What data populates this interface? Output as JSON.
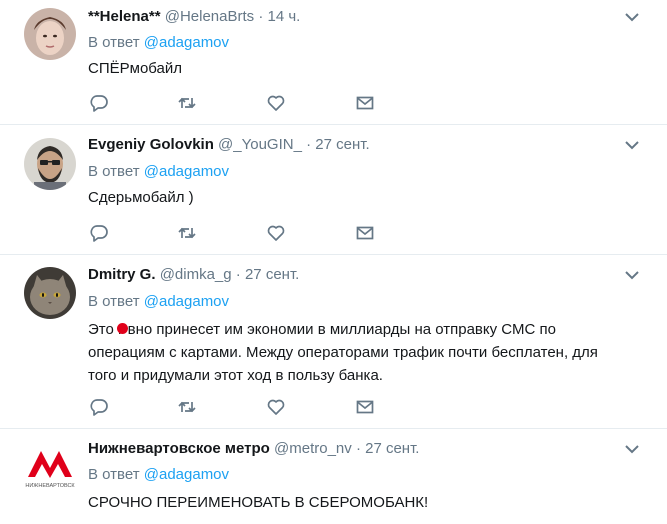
{
  "tweets": [
    {
      "name": "**Helena**",
      "handle": "@HelenaBrts",
      "dot": "·",
      "time": "14 ч.",
      "reply_prefix": "В ответ",
      "reply_to": "@adagamov",
      "text_lines": [
        "СПЁРмобайл"
      ]
    },
    {
      "name": "Evgeniy Golovkin",
      "handle": "@_YouGIN_",
      "dot": "·",
      "time": "27 сент.",
      "reply_prefix": "В ответ",
      "reply_to": "@adagamov",
      "text_lines": [
        "Сдерьмобайл )"
      ]
    },
    {
      "name": "Dmitry G.",
      "handle": "@dimka_g",
      "dot": "·",
      "time": "27 сент.",
      "reply_prefix": "В ответ",
      "reply_to": "@adagamov",
      "text_lines": [
        "Это г вно принесет им экономии в миллиарды на отправку СМС по",
        "операциям с картами. Между операторами трафик почти бесплатен, для",
        "того и придумали этот ход в пользу банка."
      ]
    },
    {
      "name": "Нижневартовское метро",
      "handle": "@metro_nv",
      "dot": "·",
      "time": "27 сент.",
      "reply_prefix": "В ответ",
      "reply_to": "@adagamov",
      "text_lines": [
        "СРОЧНО ПЕРЕИМЕНОВАТЬ В СБЕРОМОБАНК!"
      ],
      "logo_text": "НИЖНЕВАРТОВСК"
    }
  ],
  "colors": {
    "link": "#1da1f2",
    "secondary": "#657786",
    "divider": "#e6ecf0",
    "metro_red": "#e0001a"
  },
  "icons": [
    "reply-icon",
    "retweet-icon",
    "like-icon",
    "direct-message-icon",
    "chevron-down-icon"
  ]
}
